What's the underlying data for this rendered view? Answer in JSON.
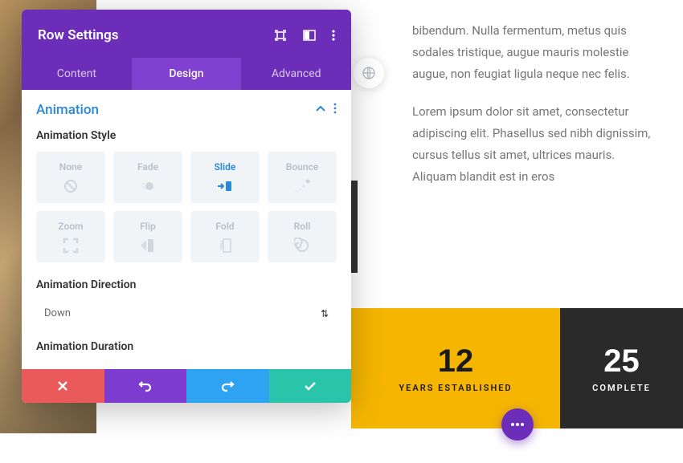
{
  "header": {
    "title": "Row Settings"
  },
  "tabs": {
    "content": "Content",
    "design": "Design",
    "advanced": "Advanced"
  },
  "section": {
    "title": "Animation"
  },
  "style": {
    "label": "Animation Style",
    "options": [
      "None",
      "Fade",
      "Slide",
      "Bounce",
      "Zoom",
      "Flip",
      "Fold",
      "Roll"
    ],
    "selected": "Slide"
  },
  "direction": {
    "label": "Animation Direction",
    "value": "Down"
  },
  "duration": {
    "label": "Animation Duration"
  },
  "content": {
    "p1": "bibendum. Nulla fermentum, metus quis sodales tristique, augue mauris molestie augue, non feugiat ligula neque nec felis.",
    "p2": "Lorem ipsum dolor sit amet, consectetur adipiscing elit. Phasellus sed nibh dignissim, cursus tellus sit amet, ultrices mauris. Aliquam blandit est in eros"
  },
  "stats": {
    "yellow": {
      "num": "12",
      "label": "YEARS ESTABLISHED"
    },
    "dark": {
      "num": "25",
      "label": "COMPLETE"
    }
  }
}
